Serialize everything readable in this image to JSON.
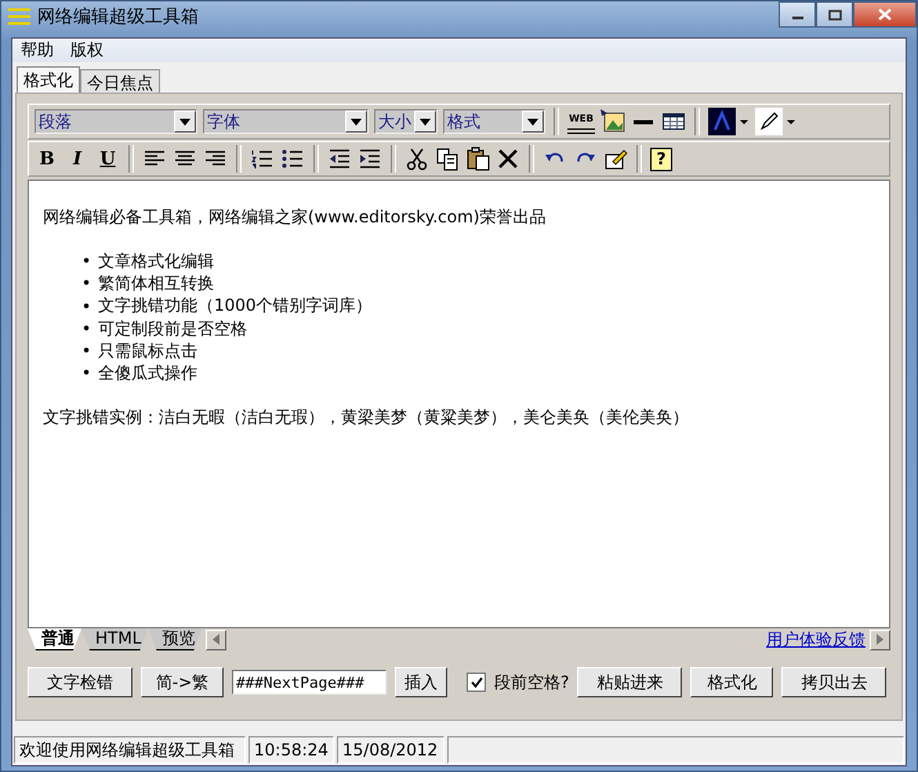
{
  "window": {
    "title": "网络编辑超级工具箱"
  },
  "menu": [
    "帮助",
    "版权"
  ],
  "tabs": [
    {
      "label": "格式化",
      "selected": true
    },
    {
      "label": "今日焦点",
      "selected": false
    }
  ],
  "toolbar": {
    "dropdowns": [
      "段落",
      "字体",
      "大小",
      "格式"
    ],
    "link_badge": "WEB",
    "format_buttons": [
      "B",
      "I",
      "U"
    ],
    "help": "?"
  },
  "editor": {
    "heading": "网络编辑必备工具箱，网络编辑之家(www.editorsky.com)荣誉出品",
    "bullet": "•",
    "bullets": [
      "文章格式化编辑",
      "繁简体相互转换",
      "文字挑错功能（1000个错别字词库）",
      "可定制段前是否空格",
      "只需鼠标点击",
      "全傻瓜式操作"
    ],
    "example": "文字挑错实例：洁白无暇（洁白无瑕），黄梁美梦（黄粱美梦），美仑美奂（美伦美奂）"
  },
  "view_tabs": [
    {
      "label": "普通",
      "selected": true
    },
    {
      "label": "HTML",
      "selected": false
    },
    {
      "label": "预览",
      "selected": false
    }
  ],
  "feedback_link": "用户体验反馈",
  "actions": {
    "check_button": "文字检错",
    "convert_button": "简->繁",
    "page_marker": "###NextPage###",
    "insert_button": "插入",
    "indent": {
      "label": "段前空格?",
      "checked": true
    },
    "paste_button": "粘贴进来",
    "format_button": "格式化",
    "copy_button": "拷贝出去"
  },
  "status_bar": [
    "欢迎使用网络编辑超级工具箱",
    "10:58:24",
    "15/08/2012"
  ]
}
